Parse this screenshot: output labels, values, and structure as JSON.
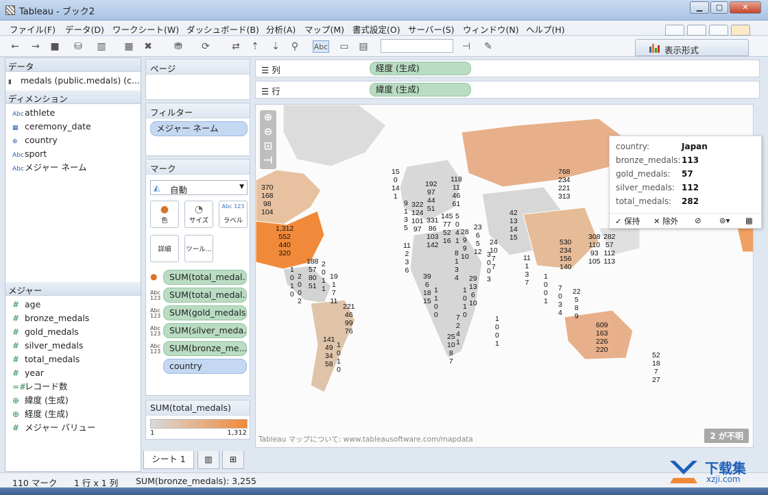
{
  "window": {
    "title": "Tableau - ブック2"
  },
  "menu": [
    "ファイル(F)",
    "データ(D)",
    "ワークシート(W)",
    "ダッシュボード(B)",
    "分析(A)",
    "マップ(M)",
    "書式設定(O)",
    "サーバー(S)",
    "ウィンドウ(N)",
    "ヘルプ(H)"
  ],
  "toolbar": {
    "label_button": "Abc",
    "show_me": "表示形式"
  },
  "data_pane": {
    "header": "データ",
    "source": "medals (public.medals) (c...",
    "dimensions_header": "ディメンション",
    "dimensions": [
      {
        "icon": "Abc",
        "name": "athlete"
      },
      {
        "icon": "cal",
        "name": "ceremony_date"
      },
      {
        "icon": "globe",
        "name": "country"
      },
      {
        "icon": "Abc",
        "name": "sport"
      },
      {
        "icon": "Abc",
        "name": "メジャー ネーム"
      }
    ],
    "measures_header": "メジャー",
    "measures": [
      {
        "icon": "#",
        "name": "age"
      },
      {
        "icon": "#",
        "name": "bronze_medals"
      },
      {
        "icon": "#",
        "name": "gold_medals"
      },
      {
        "icon": "#",
        "name": "silver_medals"
      },
      {
        "icon": "#",
        "name": "total_medals"
      },
      {
        "icon": "#",
        "name": "year"
      },
      {
        "icon": "=#",
        "name": "レコード数"
      },
      {
        "icon": "globe",
        "name": "緯度 (生成)"
      },
      {
        "icon": "globe",
        "name": "経度 (生成)"
      },
      {
        "icon": "#",
        "name": "メジャー バリュー"
      }
    ]
  },
  "pages": {
    "header": "ページ"
  },
  "filters": {
    "header": "フィルター",
    "items": [
      "メジャー ネーム"
    ]
  },
  "marks": {
    "header": "マーク",
    "type": "自動",
    "buttons": [
      "色",
      "サイズ",
      "ラベル",
      "詳細",
      "ツール..."
    ],
    "size_glyph": "◔",
    "label_glyph": "Abc 123",
    "fields": [
      "SUM(total_medal...",
      "SUM(total_medal...",
      "SUM(gold_medals)",
      "SUM(silver_meda...",
      "SUM(bronze_me...",
      "country"
    ]
  },
  "legend": {
    "title": "SUM(total_medals)",
    "min": "1",
    "max": "1,312",
    "color_min": "#d9d9d9",
    "color_max": "#f08a3a"
  },
  "shelves": {
    "columns_label": "列",
    "columns_pill": "経度 (生成)",
    "rows_label": "行",
    "rows_pill": "緯度 (生成)"
  },
  "map": {
    "credit": "Tableau マップについて:  www.tableausoftware.com/mapdata",
    "unknown_badge": "2 が不明",
    "labels": [
      "15\n0\n14\n1",
      "370\n168\n98\n104",
      "1,312\n552\n440\n320",
      "768\n234\n221\n313",
      "192\n97\n44\n51",
      "118\n11\n46\n61",
      "9\n1\n3\n5",
      "322\n124\n101\n97",
      "331\n86\n103\n142",
      "145\n77\n52\n16",
      "5\n0\n4\n1",
      "28\n9\n9\n10",
      "23\n6\n5\n12",
      "42\n13\n14\n15",
      "530\n234\n156\n140",
      "308\n110\n93\n105",
      "282\n57\n112\n113",
      "11\n2\n3\n6",
      "188\n57\n80\n51",
      "2\n0\n1\n1",
      "19\n1\n7\n11",
      "1\n0\n1\n0",
      "2\n0\n0\n2",
      "221\n46\n99\n76",
      "39\n6\n18\n15",
      "8\n1\n3\n4",
      "24\n10\n7\n7",
      "3\n0\n0\n3",
      "11\n1\n3\n7",
      "1\n0\n0\n1",
      "1\n1\n0\n0",
      "29\n13\n6\n10",
      "1\n0\n1\n0",
      "7\n0\n3\n4",
      "22\n5\n8\n9",
      "141\n49\n34\n58",
      "1\n0\n1\n0",
      "7\n2\n4\n1",
      "25\n10\n8\n7",
      "1\n0\n0\n1",
      "609\n163\n226\n220",
      "52\n18\n7\n27"
    ]
  },
  "tooltip": {
    "rows": [
      {
        "k": "country:",
        "v": "Japan"
      },
      {
        "k": "bronze_medals:",
        "v": "113"
      },
      {
        "k": "gold_medals:",
        "v": "57"
      },
      {
        "k": "silver_medals:",
        "v": "112"
      },
      {
        "k": "total_medals:",
        "v": "282"
      }
    ],
    "keep": "✓ 保持",
    "exclude": "✕ 除外"
  },
  "sheets": {
    "active": "シート 1"
  },
  "status": {
    "marks": "110 マーク",
    "dims": "1 行 x 1 列",
    "sum": "SUM(bronze_medals): 3,255"
  },
  "watermark": {
    "title": "下载集",
    "url": "xzji.com"
  }
}
